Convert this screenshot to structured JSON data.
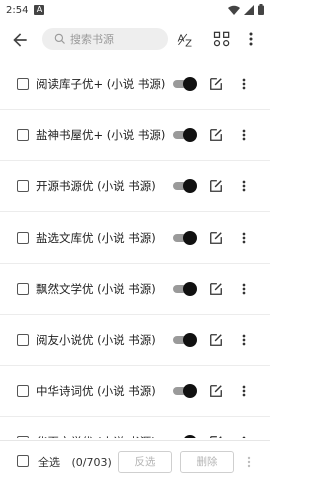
{
  "status": {
    "time": "2:54",
    "notification_glyph": "A"
  },
  "toolbar": {
    "search_placeholder": "搜索书源"
  },
  "sources": [
    {
      "name": "阅读库子优+ (小说 书源)",
      "enabled": true
    },
    {
      "name": "盐神书屋优+ (小说 书源)",
      "enabled": true
    },
    {
      "name": "开源书源优 (小说 书源)",
      "enabled": true
    },
    {
      "name": "盐选文库优 (小说 书源)",
      "enabled": true
    },
    {
      "name": "飘然文学优 (小说 书源)",
      "enabled": true
    },
    {
      "name": "阅友小说优 (小说 书源)",
      "enabled": true
    },
    {
      "name": "中华诗词优 (小说 书源)",
      "enabled": true
    },
    {
      "name": "华夏文学优 (小说 书源)",
      "enabled": true
    }
  ],
  "bottom": {
    "select_all_label": "全选",
    "selection_count": "(0/703)",
    "invert_label": "反选",
    "delete_label": "删除"
  },
  "colors": {
    "accent": "#111111",
    "track": "#9a9a9a",
    "disabled_text": "#b5b5b5"
  }
}
